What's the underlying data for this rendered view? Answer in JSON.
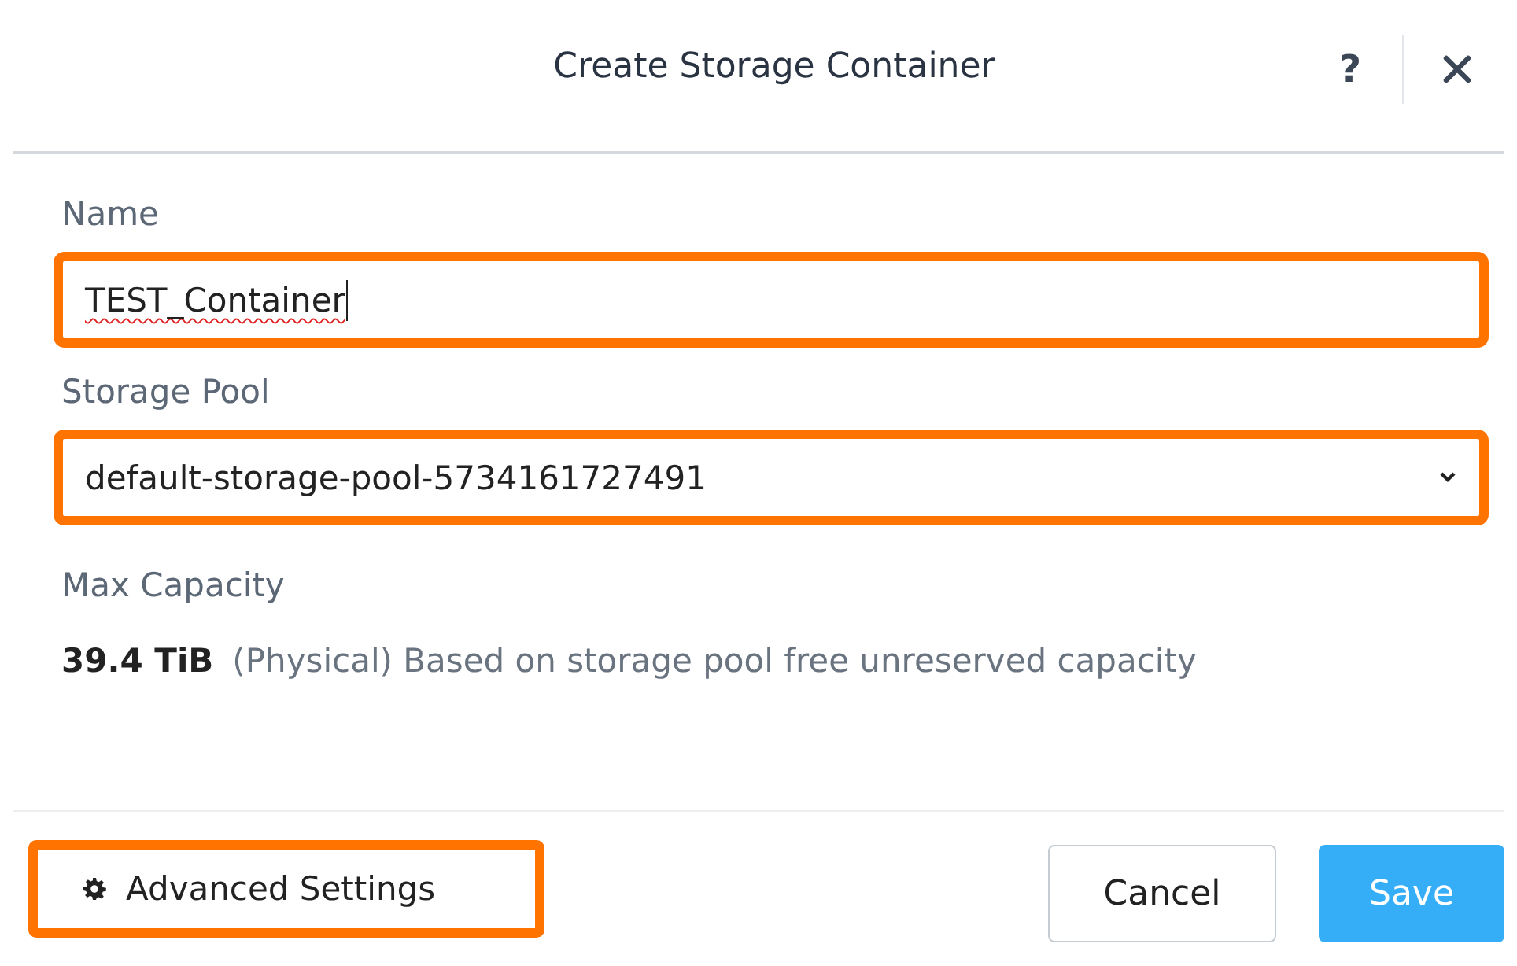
{
  "dialog": {
    "title": "Create Storage Container",
    "help": "?"
  },
  "fields": [
    {
      "kind": "text",
      "label": "Name",
      "value": "TEST_Container",
      "misspelled": true,
      "highlighted": true
    },
    {
      "kind": "select",
      "label": "Storage Pool",
      "value": "default-storage-pool-5734161727491",
      "highlighted": true
    }
  ],
  "capacity": {
    "label": "Max Capacity",
    "amount": "39.4 TiB",
    "note": "(Physical) Based on storage pool free unreserved capacity"
  },
  "footer": {
    "advanced": {
      "label": "Advanced Settings",
      "highlighted": true
    },
    "buttons": [
      {
        "label": "Cancel",
        "kind": "secondary"
      },
      {
        "label": "Save",
        "kind": "primary"
      }
    ]
  }
}
